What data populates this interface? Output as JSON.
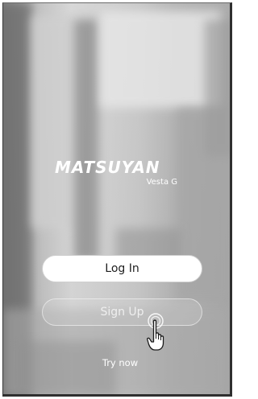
{
  "brand": {
    "name": "MATSUYAN",
    "model": "Vesta G"
  },
  "actions": {
    "login_label": "Log In",
    "signup_label": "Sign Up",
    "try_label": "Try now"
  },
  "cursor": {
    "icon": "hand-pointer-icon"
  },
  "colors": {
    "login_bg": "#ffffff",
    "login_text": "#1e1e1e",
    "signup_text": "#efefef",
    "brand_text": "#ffffff"
  }
}
